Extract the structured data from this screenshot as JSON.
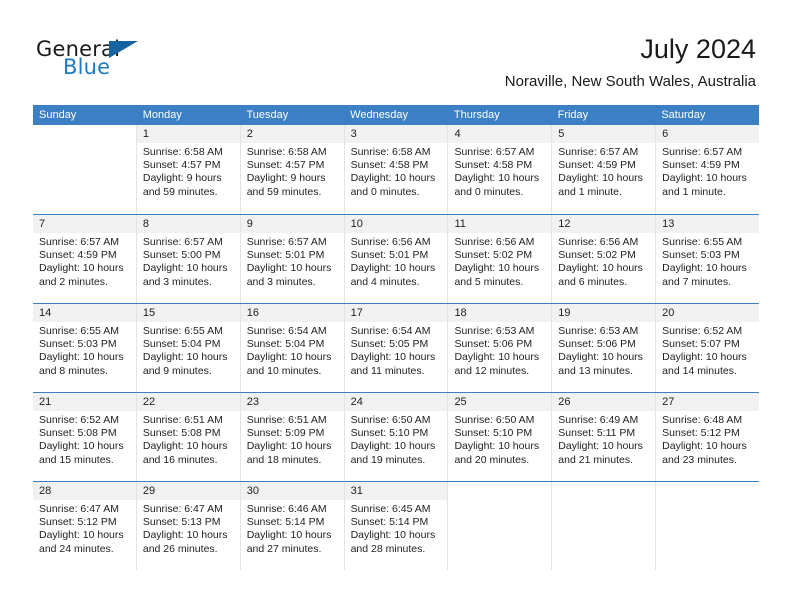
{
  "brand": {
    "name_top": "General",
    "name_bottom": "Blue",
    "triangle_color": "#15639f",
    "blue_color": "#1f7bc1"
  },
  "header": {
    "title": "July 2024",
    "subtitle": "Noraville, New South Wales, Australia"
  },
  "theme": {
    "header_blue": "#3b80c4",
    "day_band_gray": "#f1f1f1",
    "cell_border": "#e3e3e3"
  },
  "weekdays": [
    "Sunday",
    "Monday",
    "Tuesday",
    "Wednesday",
    "Thursday",
    "Friday",
    "Saturday"
  ],
  "weeks": [
    [
      {
        "day": "",
        "sunrise": "",
        "sunset": "",
        "daylight_line1": "",
        "daylight_line2": "",
        "blank": true
      },
      {
        "day": "1",
        "sunrise": "Sunrise: 6:58 AM",
        "sunset": "Sunset: 4:57 PM",
        "daylight_line1": "Daylight: 9 hours",
        "daylight_line2": "and 59 minutes."
      },
      {
        "day": "2",
        "sunrise": "Sunrise: 6:58 AM",
        "sunset": "Sunset: 4:57 PM",
        "daylight_line1": "Daylight: 9 hours",
        "daylight_line2": "and 59 minutes."
      },
      {
        "day": "3",
        "sunrise": "Sunrise: 6:58 AM",
        "sunset": "Sunset: 4:58 PM",
        "daylight_line1": "Daylight: 10 hours",
        "daylight_line2": "and 0 minutes."
      },
      {
        "day": "4",
        "sunrise": "Sunrise: 6:57 AM",
        "sunset": "Sunset: 4:58 PM",
        "daylight_line1": "Daylight: 10 hours",
        "daylight_line2": "and 0 minutes."
      },
      {
        "day": "5",
        "sunrise": "Sunrise: 6:57 AM",
        "sunset": "Sunset: 4:59 PM",
        "daylight_line1": "Daylight: 10 hours",
        "daylight_line2": "and 1 minute."
      },
      {
        "day": "6",
        "sunrise": "Sunrise: 6:57 AM",
        "sunset": "Sunset: 4:59 PM",
        "daylight_line1": "Daylight: 10 hours",
        "daylight_line2": "and 1 minute."
      }
    ],
    [
      {
        "day": "7",
        "sunrise": "Sunrise: 6:57 AM",
        "sunset": "Sunset: 4:59 PM",
        "daylight_line1": "Daylight: 10 hours",
        "daylight_line2": "and 2 minutes."
      },
      {
        "day": "8",
        "sunrise": "Sunrise: 6:57 AM",
        "sunset": "Sunset: 5:00 PM",
        "daylight_line1": "Daylight: 10 hours",
        "daylight_line2": "and 3 minutes."
      },
      {
        "day": "9",
        "sunrise": "Sunrise: 6:57 AM",
        "sunset": "Sunset: 5:01 PM",
        "daylight_line1": "Daylight: 10 hours",
        "daylight_line2": "and 3 minutes."
      },
      {
        "day": "10",
        "sunrise": "Sunrise: 6:56 AM",
        "sunset": "Sunset: 5:01 PM",
        "daylight_line1": "Daylight: 10 hours",
        "daylight_line2": "and 4 minutes."
      },
      {
        "day": "11",
        "sunrise": "Sunrise: 6:56 AM",
        "sunset": "Sunset: 5:02 PM",
        "daylight_line1": "Daylight: 10 hours",
        "daylight_line2": "and 5 minutes."
      },
      {
        "day": "12",
        "sunrise": "Sunrise: 6:56 AM",
        "sunset": "Sunset: 5:02 PM",
        "daylight_line1": "Daylight: 10 hours",
        "daylight_line2": "and 6 minutes."
      },
      {
        "day": "13",
        "sunrise": "Sunrise: 6:55 AM",
        "sunset": "Sunset: 5:03 PM",
        "daylight_line1": "Daylight: 10 hours",
        "daylight_line2": "and 7 minutes."
      }
    ],
    [
      {
        "day": "14",
        "sunrise": "Sunrise: 6:55 AM",
        "sunset": "Sunset: 5:03 PM",
        "daylight_line1": "Daylight: 10 hours",
        "daylight_line2": "and 8 minutes."
      },
      {
        "day": "15",
        "sunrise": "Sunrise: 6:55 AM",
        "sunset": "Sunset: 5:04 PM",
        "daylight_line1": "Daylight: 10 hours",
        "daylight_line2": "and 9 minutes."
      },
      {
        "day": "16",
        "sunrise": "Sunrise: 6:54 AM",
        "sunset": "Sunset: 5:04 PM",
        "daylight_line1": "Daylight: 10 hours",
        "daylight_line2": "and 10 minutes."
      },
      {
        "day": "17",
        "sunrise": "Sunrise: 6:54 AM",
        "sunset": "Sunset: 5:05 PM",
        "daylight_line1": "Daylight: 10 hours",
        "daylight_line2": "and 11 minutes."
      },
      {
        "day": "18",
        "sunrise": "Sunrise: 6:53 AM",
        "sunset": "Sunset: 5:06 PM",
        "daylight_line1": "Daylight: 10 hours",
        "daylight_line2": "and 12 minutes."
      },
      {
        "day": "19",
        "sunrise": "Sunrise: 6:53 AM",
        "sunset": "Sunset: 5:06 PM",
        "daylight_line1": "Daylight: 10 hours",
        "daylight_line2": "and 13 minutes."
      },
      {
        "day": "20",
        "sunrise": "Sunrise: 6:52 AM",
        "sunset": "Sunset: 5:07 PM",
        "daylight_line1": "Daylight: 10 hours",
        "daylight_line2": "and 14 minutes."
      }
    ],
    [
      {
        "day": "21",
        "sunrise": "Sunrise: 6:52 AM",
        "sunset": "Sunset: 5:08 PM",
        "daylight_line1": "Daylight: 10 hours",
        "daylight_line2": "and 15 minutes."
      },
      {
        "day": "22",
        "sunrise": "Sunrise: 6:51 AM",
        "sunset": "Sunset: 5:08 PM",
        "daylight_line1": "Daylight: 10 hours",
        "daylight_line2": "and 16 minutes."
      },
      {
        "day": "23",
        "sunrise": "Sunrise: 6:51 AM",
        "sunset": "Sunset: 5:09 PM",
        "daylight_line1": "Daylight: 10 hours",
        "daylight_line2": "and 18 minutes."
      },
      {
        "day": "24",
        "sunrise": "Sunrise: 6:50 AM",
        "sunset": "Sunset: 5:10 PM",
        "daylight_line1": "Daylight: 10 hours",
        "daylight_line2": "and 19 minutes."
      },
      {
        "day": "25",
        "sunrise": "Sunrise: 6:50 AM",
        "sunset": "Sunset: 5:10 PM",
        "daylight_line1": "Daylight: 10 hours",
        "daylight_line2": "and 20 minutes."
      },
      {
        "day": "26",
        "sunrise": "Sunrise: 6:49 AM",
        "sunset": "Sunset: 5:11 PM",
        "daylight_line1": "Daylight: 10 hours",
        "daylight_line2": "and 21 minutes."
      },
      {
        "day": "27",
        "sunrise": "Sunrise: 6:48 AM",
        "sunset": "Sunset: 5:12 PM",
        "daylight_line1": "Daylight: 10 hours",
        "daylight_line2": "and 23 minutes."
      }
    ],
    [
      {
        "day": "28",
        "sunrise": "Sunrise: 6:47 AM",
        "sunset": "Sunset: 5:12 PM",
        "daylight_line1": "Daylight: 10 hours",
        "daylight_line2": "and 24 minutes."
      },
      {
        "day": "29",
        "sunrise": "Sunrise: 6:47 AM",
        "sunset": "Sunset: 5:13 PM",
        "daylight_line1": "Daylight: 10 hours",
        "daylight_line2": "and 26 minutes."
      },
      {
        "day": "30",
        "sunrise": "Sunrise: 6:46 AM",
        "sunset": "Sunset: 5:14 PM",
        "daylight_line1": "Daylight: 10 hours",
        "daylight_line2": "and 27 minutes."
      },
      {
        "day": "31",
        "sunrise": "Sunrise: 6:45 AM",
        "sunset": "Sunset: 5:14 PM",
        "daylight_line1": "Daylight: 10 hours",
        "daylight_line2": "and 28 minutes."
      },
      {
        "day": "",
        "sunrise": "",
        "sunset": "",
        "daylight_line1": "",
        "daylight_line2": "",
        "blank": true
      },
      {
        "day": "",
        "sunrise": "",
        "sunset": "",
        "daylight_line1": "",
        "daylight_line2": "",
        "blank": true
      },
      {
        "day": "",
        "sunrise": "",
        "sunset": "",
        "daylight_line1": "",
        "daylight_line2": "",
        "blank": true
      }
    ]
  ]
}
